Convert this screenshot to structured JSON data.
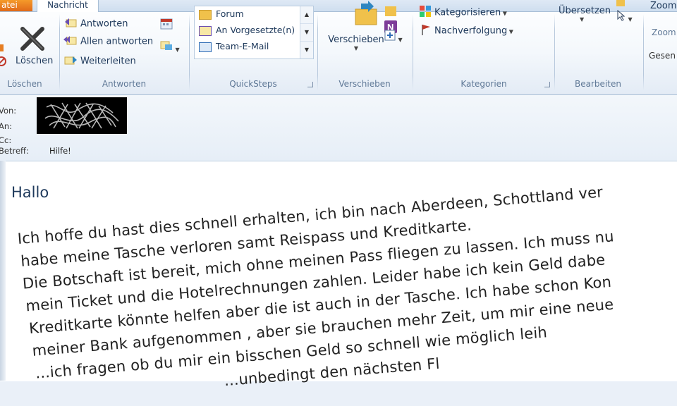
{
  "ribbon": {
    "file_tab": "atei",
    "active_tab": "Nachricht",
    "groups": {
      "loeschen": {
        "label": "Löschen",
        "delete_button": "Löschen"
      },
      "antworten": {
        "label": "Antworten",
        "reply": "Antworten",
        "reply_all": "Allen antworten",
        "forward": "Weiterleiten"
      },
      "quicksteps": {
        "label": "QuickSteps",
        "items": [
          "Forum",
          "An Vorgesetzte(n)",
          "Team-E-Mail"
        ]
      },
      "verschieben": {
        "label": "Verschieben",
        "move_button": "Verschieben"
      },
      "kategorien": {
        "label": "Kategorien",
        "categorize": "Kategorisieren",
        "followup": "Nachverfolgung"
      },
      "bearbeiten": {
        "label": "Bearbeiten",
        "translate": "Übersetzen"
      },
      "zoom": {
        "label": "Zoom",
        "zoom_button": "Zoom"
      },
      "gesendet_partial": "Gesen"
    }
  },
  "header": {
    "from_label": "Von:",
    "to_label": "An:",
    "cc_label": "Cc:",
    "subject_label": "Betreff:",
    "subject_value": "Hilfe!"
  },
  "body": {
    "greeting": "Hallo",
    "lines": [
      "Ich hoffe du hast dies schnell erhalten, ich bin nach Aberdeen, Schottland ver",
      "habe meine Tasche verloren samt Reispass und Kreditkarte.",
      "Die Botschaft ist bereit, mich ohne meinen Pass fliegen zu lassen. Ich muss nu",
      "mein Ticket und die Hotelrechnungen zahlen. Leider habe ich kein Geld dabe",
      "Kreditkarte könnte helfen aber die ist auch in der Tasche. Ich habe schon Kon",
      "meiner Bank aufgenommen , aber sie brauchen mehr Zeit, um mir eine neue",
      "...ich fragen ob du mir ein bisschen Geld so schnell wie möglich leih",
      "...unbedingt den nächsten Fl"
    ]
  },
  "colors": {
    "file_tab": "#e0691a",
    "ribbon_text": "#1e395b",
    "group_label": "#5f7896"
  }
}
